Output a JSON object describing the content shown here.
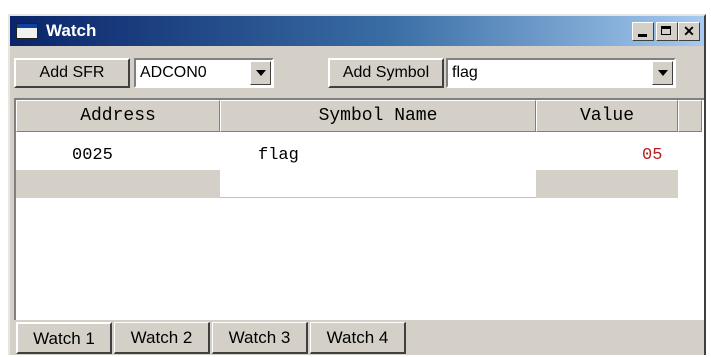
{
  "window": {
    "title": "Watch"
  },
  "toolbar": {
    "add_sfr_label": "Add SFR",
    "sfr_value": "ADCON0",
    "add_symbol_label": "Add Symbol",
    "symbol_value": "flag"
  },
  "table": {
    "headers": [
      "Address",
      "Symbol Name",
      "Value"
    ],
    "rows": [
      {
        "address": "0025",
        "symbol": "flag",
        "value": "05"
      }
    ],
    "value_color": "#b22222"
  },
  "tabs": [
    "Watch 1",
    "Watch 2",
    "Watch 3",
    "Watch 4"
  ],
  "active_tab": "Watch 1",
  "colors": {
    "titlebar_start": "#0a246a",
    "titlebar_end": "#a6caf0",
    "face": "#d4d0c8"
  }
}
